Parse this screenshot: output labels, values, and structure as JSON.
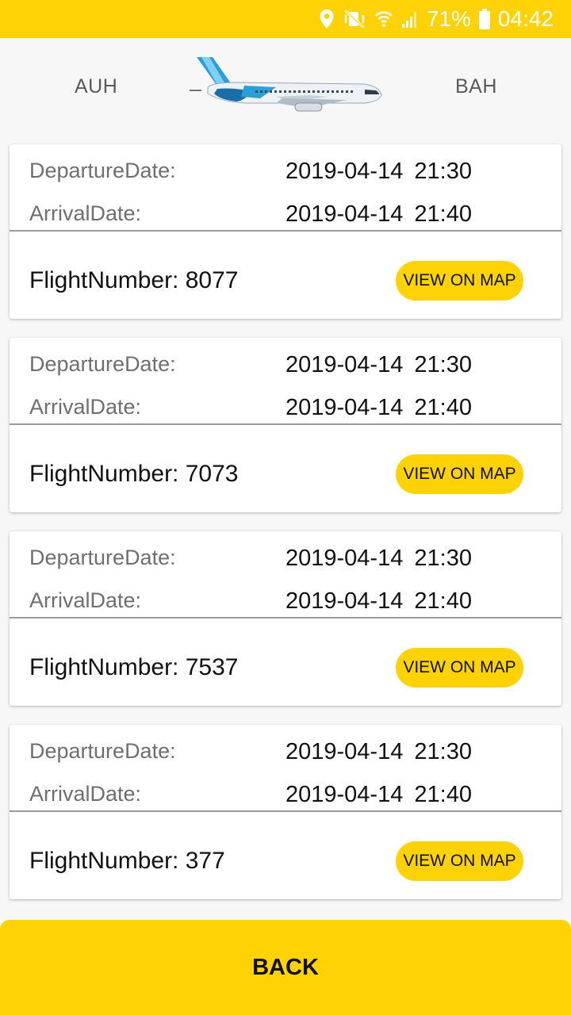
{
  "status_bar": {
    "battery_percent": "71%",
    "time": "04:42",
    "icons": [
      "location-icon",
      "mute-vibrate-icon",
      "wifi-icon",
      "signal-icon",
      "battery-icon"
    ]
  },
  "route": {
    "origin": "AUH",
    "destination": "BAH",
    "image": "airplane-illustration"
  },
  "flights": [
    {
      "departure_label": "DepartureDate:",
      "departure_value": "2019-04-14  21:30",
      "arrival_label": "ArrivalDate:",
      "arrival_value": "2019-04-14  21:40",
      "flight_number_text": "FlightNumber: 8077",
      "map_button": "VIEW ON MAP"
    },
    {
      "departure_label": "DepartureDate:",
      "departure_value": "2019-04-14  21:30",
      "arrival_label": "ArrivalDate:",
      "arrival_value": "2019-04-14  21:40",
      "flight_number_text": "FlightNumber: 7073",
      "map_button": "VIEW ON MAP"
    },
    {
      "departure_label": "DepartureDate:",
      "departure_value": "2019-04-14  21:30",
      "arrival_label": "ArrivalDate:",
      "arrival_value": "2019-04-14  21:40",
      "flight_number_text": "FlightNumber: 7537",
      "map_button": "VIEW ON MAP"
    },
    {
      "departure_label": "DepartureDate:",
      "departure_value": "2019-04-14  21:30",
      "arrival_label": "ArrivalDate:",
      "arrival_value": "2019-04-14  21:40",
      "flight_number_text": "FlightNumber: 377",
      "map_button": "VIEW ON MAP"
    }
  ],
  "back_button": "BACK",
  "colors": {
    "accent": "#fed204",
    "background": "#f7f7f7",
    "card": "#ffffff",
    "label_text": "#6f6f6f",
    "value_text": "#111111"
  }
}
